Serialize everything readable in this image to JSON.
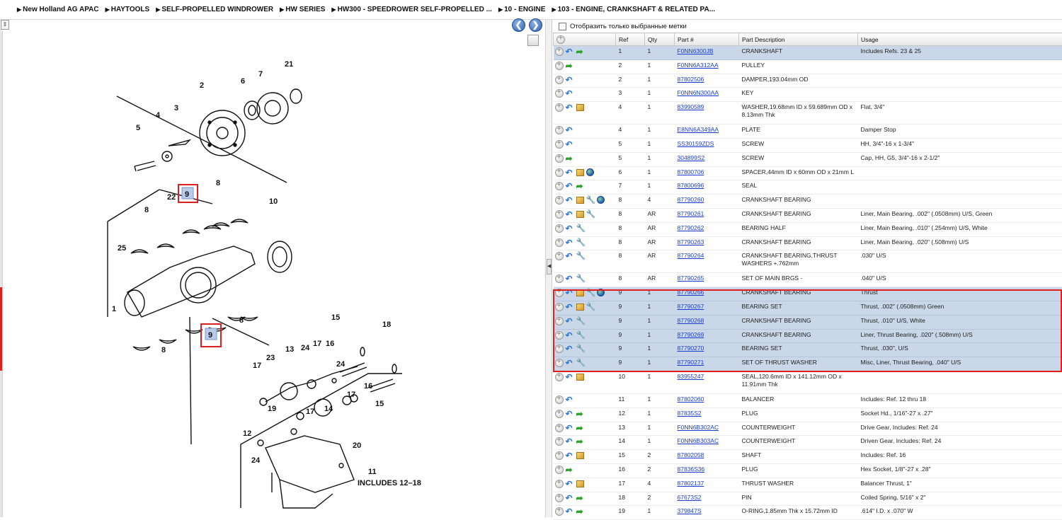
{
  "breadcrumb": [
    "New Holland AG APAC",
    "HAYTOOLS",
    "SELF-PROPELLED WINDROWER",
    "HW SERIES",
    "HW300 - SPEEDROWER SELF-PROPELLED ...",
    "10 - ENGINE",
    "103 - ENGINE, CRANKSHAFT & RELATED PA..."
  ],
  "filter_label": "Отобразить только выбранные метки",
  "columns": {
    "ref": "Ref",
    "qty": "Qty",
    "part": "Part #",
    "desc": "Part Description",
    "usage": "Usage"
  },
  "nav": {
    "prev": "❮",
    "next": "❯"
  },
  "colors": {
    "selected_row": "#c9d7e8",
    "highlight_frame": "#e01e1e",
    "link": "#1a3fcf"
  },
  "diagram": {
    "callouts": [
      "1",
      "2",
      "3",
      "4",
      "5",
      "6",
      "7",
      "8",
      "8",
      "8",
      "8",
      "9",
      "9",
      "10",
      "11",
      "12",
      "13",
      "14",
      "15",
      "15",
      "16",
      "16",
      "17",
      "17",
      "17",
      "17",
      "18",
      "19",
      "20",
      "21",
      "22",
      "23",
      "24",
      "24",
      "24",
      "25"
    ],
    "note": "INCLUDES 12–18"
  },
  "parts": [
    {
      "ref": "1",
      "qty": "1",
      "part": "F0NN6300JB",
      "desc": "CRANKSHAFT",
      "usage": "Includes Refs. 23 & 25",
      "icons": [
        "plus",
        "arrow",
        "green"
      ],
      "sel": true
    },
    {
      "ref": "2",
      "qty": "1",
      "part": "F0NN6A312AA",
      "desc": "PULLEY",
      "usage": "",
      "icons": [
        "plus",
        "green"
      ]
    },
    {
      "ref": "2",
      "qty": "1",
      "part": "87802506",
      "desc": "DAMPER,193.04mm OD",
      "usage": "",
      "icons": [
        "plus",
        "arrow"
      ]
    },
    {
      "ref": "3",
      "qty": "1",
      "part": "F0NN6N300AA",
      "desc": "KEY",
      "usage": "",
      "icons": [
        "plus",
        "arrow"
      ]
    },
    {
      "ref": "4",
      "qty": "1",
      "part": "83990589",
      "desc": "WASHER,19.68mm ID x 59.689mm OD x 8.13mm Thk",
      "usage": "Flat, 3/4\"",
      "icons": [
        "plus",
        "arrow",
        "box"
      ],
      "tall": true
    },
    {
      "ref": "4",
      "qty": "1",
      "part": "E8NN6A349AA",
      "desc": "PLATE",
      "usage": "Damper Stop",
      "icons": [
        "plus",
        "arrow"
      ]
    },
    {
      "ref": "5",
      "qty": "1",
      "part": "SS30159ZDS",
      "desc": "SCREW",
      "usage": "HH, 3/4\"-16 x 1-3/4\"",
      "icons": [
        "plus",
        "arrow"
      ]
    },
    {
      "ref": "5",
      "qty": "1",
      "part": "304899S2",
      "desc": "SCREW",
      "usage": "Cap, HH, G5, 3/4\"-16 x 2-1/2\"",
      "icons": [
        "plus",
        "green"
      ]
    },
    {
      "ref": "6",
      "qty": "1",
      "part": "87800706",
      "desc": "SPACER,44mm ID x 60mm OD x 21mm L",
      "usage": "",
      "icons": [
        "plus",
        "arrow",
        "box",
        "globe"
      ]
    },
    {
      "ref": "7",
      "qty": "1",
      "part": "87800696",
      "desc": "SEAL",
      "usage": "",
      "icons": [
        "plus",
        "arrow",
        "green"
      ]
    },
    {
      "ref": "8",
      "qty": "4",
      "part": "87790260",
      "desc": "CRANKSHAFT BEARING",
      "usage": "",
      "icons": [
        "plus",
        "arrow",
        "box",
        "wrench",
        "globe"
      ]
    },
    {
      "ref": "8",
      "qty": "AR",
      "part": "87790261",
      "desc": "CRANKSHAFT BEARING",
      "usage": "Liner, Main Bearing, .002\" (.0508mm) U/S, Green",
      "icons": [
        "plus",
        "arrow",
        "box",
        "wrench"
      ]
    },
    {
      "ref": "8",
      "qty": "AR",
      "part": "87790262",
      "desc": "BEARING HALF",
      "usage": "Liner, Main Bearing, .010\" (.254mm) U/S, White",
      "icons": [
        "plus",
        "arrow",
        "wrench"
      ]
    },
    {
      "ref": "8",
      "qty": "AR",
      "part": "87790263",
      "desc": "CRANKSHAFT BEARING",
      "usage": "Liner, Main Bearing, .020\" (.508mm) U/S",
      "icons": [
        "plus",
        "arrow",
        "wrench"
      ]
    },
    {
      "ref": "8",
      "qty": "AR",
      "part": "87790264",
      "desc": "CRANKSHAFT BEARING,THRUST WASHERS +.762mm",
      "usage": ".030\" U/S",
      "icons": [
        "plus",
        "arrow",
        "wrench"
      ],
      "tall": true
    },
    {
      "ref": "8",
      "qty": "AR",
      "part": "87790265",
      "desc": "SET OF MAIN BRGS   -",
      "usage": ".040\" U/S",
      "icons": [
        "plus",
        "arrow",
        "wrench"
      ]
    },
    {
      "ref": "9",
      "qty": "1",
      "part": "87790266",
      "desc": "CRANKSHAFT BEARING",
      "usage": "Thrust",
      "icons": [
        "plus",
        "arrow",
        "box",
        "wrench",
        "globe"
      ],
      "sel": true
    },
    {
      "ref": "9",
      "qty": "1",
      "part": "87790267",
      "desc": "BEARING SET",
      "usage": "Thrust, .002\" (.0508mm) Green",
      "icons": [
        "plus",
        "arrow",
        "box",
        "wrench"
      ],
      "sel": true
    },
    {
      "ref": "9",
      "qty": "1",
      "part": "87790268",
      "desc": "CRANKSHAFT BEARING",
      "usage": "Thrust, .010\" U/S, White",
      "icons": [
        "plus",
        "arrow",
        "wrench"
      ],
      "sel": true
    },
    {
      "ref": "9",
      "qty": "1",
      "part": "87790269",
      "desc": "CRANKSHAFT BEARING",
      "usage": "Liner, Thrust Bearing, .020\" (.508mm) U/S",
      "icons": [
        "plus",
        "arrow",
        "wrench"
      ],
      "sel": true
    },
    {
      "ref": "9",
      "qty": "1",
      "part": "87790270",
      "desc": "BEARING SET",
      "usage": "Thrust, .030\", U/S",
      "icons": [
        "plus",
        "arrow",
        "wrench"
      ],
      "sel": true
    },
    {
      "ref": "9",
      "qty": "1",
      "part": "87790271",
      "desc": "SET OF THRUST WASHER",
      "usage": "Misc, Liner, Thrust Bearing, .040\" U/S",
      "icons": [
        "plus",
        "arrow",
        "wrench"
      ],
      "sel": true
    },
    {
      "ref": "10",
      "qty": "1",
      "part": "83955247",
      "desc": "SEAL,120.6mm ID x 141.12mm OD x 11.91mm Thk",
      "usage": "",
      "icons": [
        "plus",
        "arrow",
        "box"
      ],
      "tall": true
    },
    {
      "ref": "11",
      "qty": "1",
      "part": "87802060",
      "desc": "BALANCER",
      "usage": "Includes: Ref. 12 thru 18",
      "icons": [
        "plus",
        "arrow"
      ]
    },
    {
      "ref": "12",
      "qty": "1",
      "part": "87835S2",
      "desc": "PLUG",
      "usage": "Socket Hd., 1/16\"-27 x .27\"",
      "icons": [
        "plus",
        "arrow",
        "green"
      ]
    },
    {
      "ref": "13",
      "qty": "1",
      "part": "F0NN6B302AC",
      "desc": "COUNTERWEIGHT",
      "usage": "Drive Gear, Includes: Ref. 24",
      "icons": [
        "plus",
        "arrow",
        "green"
      ]
    },
    {
      "ref": "14",
      "qty": "1",
      "part": "F0NN6B303AC",
      "desc": "COUNTERWEIGHT",
      "usage": "Driven Gear, Includes: Ref. 24",
      "icons": [
        "plus",
        "arrow",
        "green"
      ]
    },
    {
      "ref": "15",
      "qty": "2",
      "part": "87802058",
      "desc": "SHAFT",
      "usage": "Includes: Ref. 16",
      "icons": [
        "plus",
        "arrow",
        "box"
      ]
    },
    {
      "ref": "16",
      "qty": "2",
      "part": "87836S36",
      "desc": "PLUG",
      "usage": "Hex Socket, 1/8\"-27 x .28\"",
      "icons": [
        "plus",
        "green"
      ]
    },
    {
      "ref": "17",
      "qty": "4",
      "part": "87802137",
      "desc": "THRUST WASHER",
      "usage": "Balancer Thrust, 1\"",
      "icons": [
        "plus",
        "arrow",
        "box"
      ]
    },
    {
      "ref": "18",
      "qty": "2",
      "part": "67673S2",
      "desc": "PIN",
      "usage": "Coiled Spring, 5/16\" x 2\"",
      "icons": [
        "plus",
        "arrow",
        "green"
      ]
    },
    {
      "ref": "19",
      "qty": "1",
      "part": "379847S",
      "desc": "O-RING,1.85mm Thk x 15.72mm ID",
      "usage": ".614\" I.D. x .070\" W",
      "icons": [
        "plus",
        "arrow",
        "green"
      ]
    }
  ]
}
